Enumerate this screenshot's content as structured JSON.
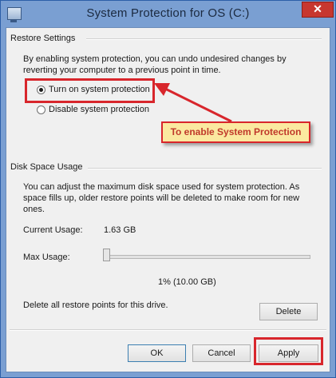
{
  "window": {
    "title": "System Protection for OS (C:)",
    "close_label": "✕"
  },
  "restore_settings": {
    "group_title": "Restore Settings",
    "description": "By enabling system protection, you can undo undesired changes by reverting your computer to a previous point in time.",
    "options": [
      {
        "label": "Turn on system protection",
        "selected": true
      },
      {
        "label": "Disable system protection",
        "selected": false
      }
    ]
  },
  "annotation": {
    "callout_text": "To enable System Protection",
    "color": "#d8262c"
  },
  "disk_space": {
    "group_title": "Disk Space Usage",
    "description": "You can adjust the maximum disk space used for system protection. As space fills up, older restore points will be deleted to make room for new ones.",
    "current_usage_label": "Current Usage:",
    "current_usage_value": "1.63 GB",
    "max_usage_label": "Max Usage:",
    "max_usage_fraction": 0.01,
    "max_usage_text": "1% (10.00 GB)",
    "delete_description": "Delete all restore points for this drive.",
    "delete_label": "Delete"
  },
  "footer": {
    "ok_label": "OK",
    "cancel_label": "Cancel",
    "apply_label": "Apply"
  },
  "colors": {
    "title_bar": "#7a9fd2",
    "close_button": "#c7372f",
    "dialog_background": "#f0f0f0"
  }
}
